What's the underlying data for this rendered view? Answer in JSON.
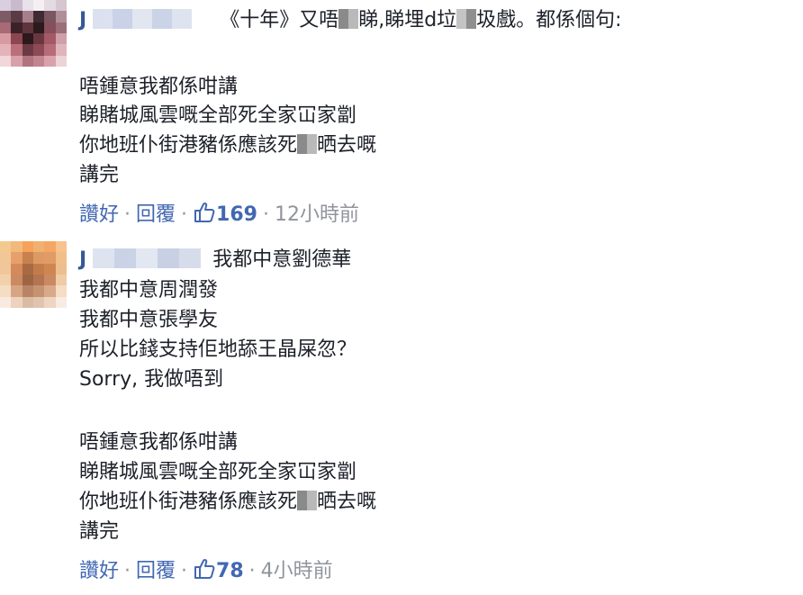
{
  "comments": [
    {
      "author": "J",
      "first_line": "《十年》又唔",
      "first_line_mid": "睇,睇埋d垃",
      "first_line_end": "圾戲。都係個句:",
      "lines": [
        "唔鍾意我都係咁講",
        "睇賭城風雲嘅全部死全家冚家劏",
        "你地班仆街港豬係應該死",
        "講完"
      ],
      "line3_end": "晒去嘅",
      "actions": {
        "like": "讚好",
        "reply": "回覆",
        "likes": "169",
        "time": "12小時前"
      }
    },
    {
      "author": "J",
      "first_line": "我都中意劉德華",
      "lines": [
        "我都中意周潤發",
        "我都中意張學友",
        "所以比錢支持佢地舔王晶屎忽？",
        "Sorry, 我做唔到"
      ],
      "lines2": [
        "唔鍾意我都係咁講",
        "睇賭城風雲嘅全部死全家冚家劏",
        "你地班仆街港豬係應該死",
        "講完"
      ],
      "line3_end": "晒去嘅",
      "actions": {
        "like": "讚好",
        "reply": "回覆",
        "likes": "78",
        "time": "4小時前"
      }
    }
  ],
  "colors": {
    "link": "#4267b2",
    "author": "#365899",
    "meta": "#90949c",
    "text": "#1d2129"
  }
}
